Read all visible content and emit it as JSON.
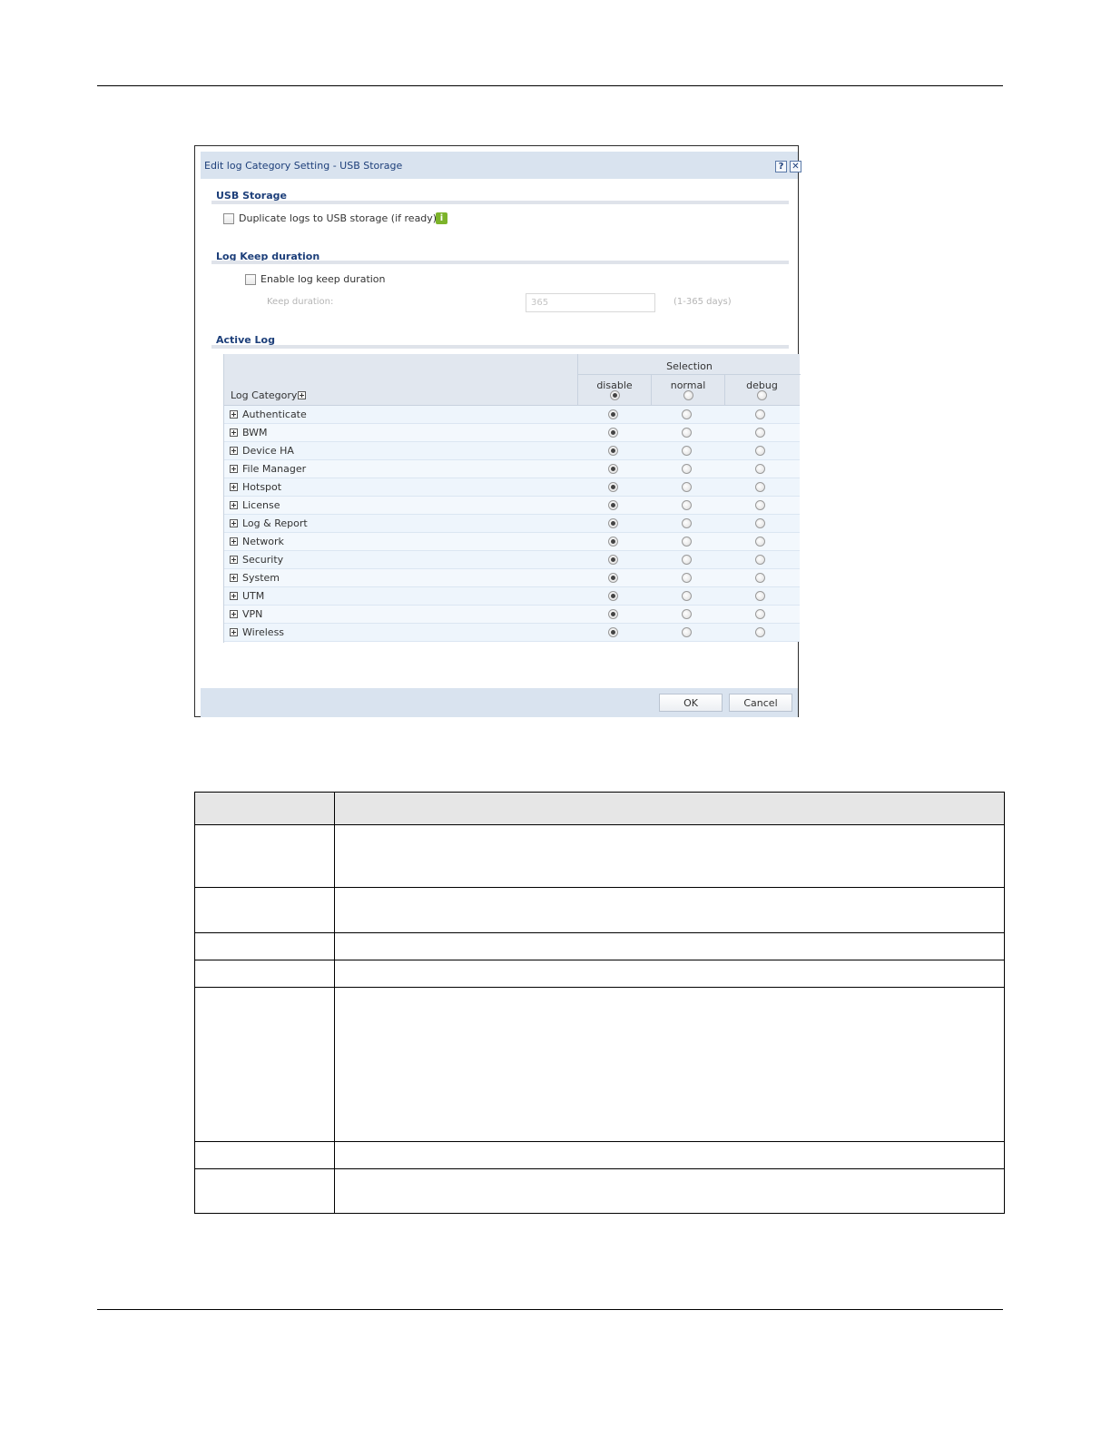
{
  "dialog": {
    "title": "Edit log Category Setting - USB Storage",
    "help_icon": "help-icon",
    "close_icon": "close-icon"
  },
  "usb_storage": {
    "section_title": "USB Storage",
    "duplicate_label": "Duplicate logs to USB storage (if ready)",
    "duplicate_checked": false,
    "info_icon": "info-icon"
  },
  "log_keep": {
    "section_title": "Log Keep duration",
    "enable_label": "Enable log keep duration",
    "enable_checked": false,
    "keep_label": "Keep duration:",
    "keep_value": "365",
    "keep_hint": "(1-365 days)"
  },
  "active_log": {
    "section_title": "Active Log",
    "col_category": "Log Category",
    "selection_title": "Selection",
    "col_disable": "disable",
    "col_normal": "normal",
    "col_debug": "debug",
    "rows": [
      {
        "label": "Authenticate",
        "selected": "disable"
      },
      {
        "label": "BWM",
        "selected": "disable"
      },
      {
        "label": "Device HA",
        "selected": "disable"
      },
      {
        "label": "File Manager",
        "selected": "disable"
      },
      {
        "label": "Hotspot",
        "selected": "disable"
      },
      {
        "label": "License",
        "selected": "disable"
      },
      {
        "label": "Log & Report",
        "selected": "disable"
      },
      {
        "label": "Network",
        "selected": "disable"
      },
      {
        "label": "Security",
        "selected": "disable"
      },
      {
        "label": "System",
        "selected": "disable"
      },
      {
        "label": "UTM",
        "selected": "disable"
      },
      {
        "label": "VPN",
        "selected": "disable"
      },
      {
        "label": "Wireless",
        "selected": "disable"
      }
    ]
  },
  "footer": {
    "ok_label": "OK",
    "cancel_label": "Cancel"
  }
}
